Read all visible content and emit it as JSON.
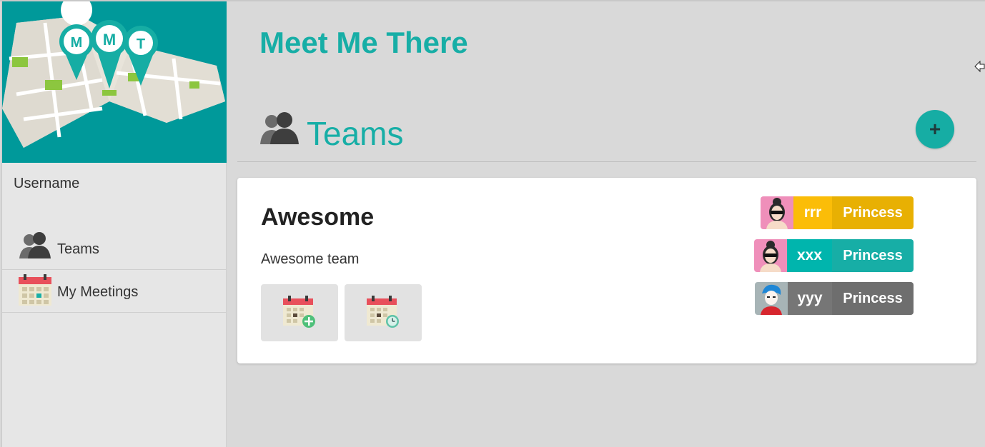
{
  "app": {
    "title": "Meet Me There",
    "logo_letters": [
      "M",
      "M",
      "T"
    ]
  },
  "sidebar": {
    "username": "Username",
    "items": [
      {
        "label": "Teams",
        "icon": "people-icon"
      },
      {
        "label": "My Meetings",
        "icon": "calendar-icon"
      }
    ]
  },
  "section": {
    "title": "Teams",
    "add_label": "+"
  },
  "team": {
    "name": "Awesome",
    "description": "Awesome team",
    "actions": [
      {
        "icon": "calendar-add-icon"
      },
      {
        "icon": "calendar-clock-icon"
      }
    ],
    "members": [
      {
        "name": "rrr",
        "role": "Princess",
        "name_color": "#fbbd08",
        "role_color": "#e8b003",
        "avatar": "avatar-girl-sunglasses-pink"
      },
      {
        "name": "xxx",
        "role": "Princess",
        "name_color": "#00b5ad",
        "role_color": "#17aea6",
        "avatar": "avatar-girl-sunglasses-pink"
      },
      {
        "name": "yyy",
        "role": "Princess",
        "name_color": "#767676",
        "role_color": "#6e6e6e",
        "avatar": "avatar-boy-blue-hair"
      }
    ]
  },
  "colors": {
    "accent": "#17aea6",
    "logo_bg": "#00999a"
  }
}
